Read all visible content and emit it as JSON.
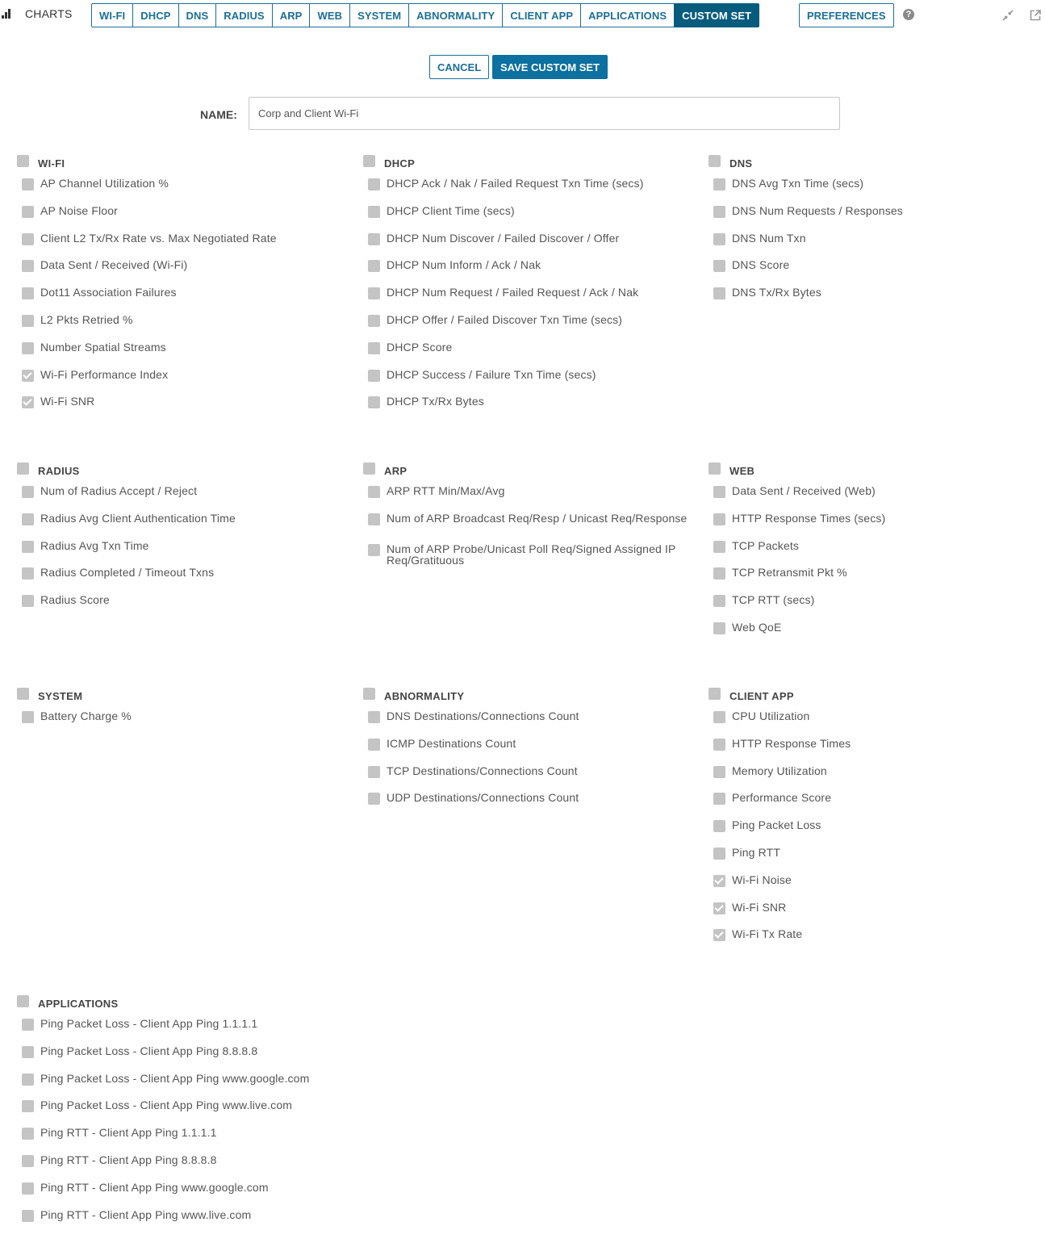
{
  "header": {
    "title": "CHARTS",
    "tabs": [
      {
        "label": "WI-FI",
        "active": false
      },
      {
        "label": "DHCP",
        "active": false
      },
      {
        "label": "DNS",
        "active": false
      },
      {
        "label": "RADIUS",
        "active": false
      },
      {
        "label": "ARP",
        "active": false
      },
      {
        "label": "WEB",
        "active": false
      },
      {
        "label": "SYSTEM",
        "active": false
      },
      {
        "label": "ABNORMALITY",
        "active": false
      },
      {
        "label": "CLIENT APP",
        "active": false
      },
      {
        "label": "APPLICATIONS",
        "active": false
      },
      {
        "label": "CUSTOM SET",
        "active": true
      }
    ],
    "preferences_label": "PREFERENCES",
    "help_glyph": "?",
    "icons": [
      "bar-chart-icon",
      "help-icon",
      "collapse-icon",
      "popout-icon"
    ]
  },
  "actions": {
    "cancel_label": "CANCEL",
    "save_label": "SAVE CUSTOM SET"
  },
  "name_field": {
    "label": "NAME:",
    "value": "Corp and Client Wi-Fi"
  },
  "colors": {
    "accent": "#1b6f98",
    "active_tab": "#075c7e",
    "save_button": "#0c70a0",
    "checkbox": "#c4c4c4"
  },
  "sections": [
    {
      "title": "WI-FI",
      "checked": false,
      "items": [
        {
          "label": "AP Channel Utilization %",
          "checked": false
        },
        {
          "label": "AP Noise Floor",
          "checked": false
        },
        {
          "label": "Client L2 Tx/Rx Rate vs. Max Negotiated Rate",
          "checked": false
        },
        {
          "label": "Data Sent / Received (Wi-Fi)",
          "checked": false
        },
        {
          "label": "Dot11 Association Failures",
          "checked": false
        },
        {
          "label": "L2 Pkts Retried %",
          "checked": false
        },
        {
          "label": "Number Spatial Streams",
          "checked": false
        },
        {
          "label": "Wi-Fi Performance Index",
          "checked": true
        },
        {
          "label": "Wi-Fi SNR",
          "checked": true
        }
      ]
    },
    {
      "title": "DHCP",
      "checked": false,
      "items": [
        {
          "label": "DHCP Ack / Nak / Failed Request Txn Time (secs)",
          "checked": false
        },
        {
          "label": "DHCP Client Time (secs)",
          "checked": false
        },
        {
          "label": "DHCP Num Discover / Failed Discover / Offer",
          "checked": false
        },
        {
          "label": "DHCP Num Inform / Ack / Nak",
          "checked": false
        },
        {
          "label": "DHCP Num Request / Failed Request / Ack / Nak",
          "checked": false
        },
        {
          "label": "DHCP Offer / Failed Discover Txn Time (secs)",
          "checked": false
        },
        {
          "label": "DHCP Score",
          "checked": false
        },
        {
          "label": "DHCP Success / Failure Txn Time (secs)",
          "checked": false
        },
        {
          "label": "DHCP Tx/Rx Bytes",
          "checked": false
        }
      ]
    },
    {
      "title": "DNS",
      "checked": false,
      "items": [
        {
          "label": "DNS Avg Txn Time (secs)",
          "checked": false
        },
        {
          "label": "DNS Num Requests / Responses",
          "checked": false
        },
        {
          "label": "DNS Num Txn",
          "checked": false
        },
        {
          "label": "DNS Score",
          "checked": false
        },
        {
          "label": "DNS Tx/Rx Bytes",
          "checked": false
        }
      ]
    },
    {
      "title": "RADIUS",
      "checked": false,
      "items": [
        {
          "label": "Num of Radius Accept / Reject",
          "checked": false
        },
        {
          "label": "Radius Avg Client Authentication Time",
          "checked": false
        },
        {
          "label": "Radius Avg Txn Time",
          "checked": false
        },
        {
          "label": "Radius Completed / Timeout Txns",
          "checked": false
        },
        {
          "label": "Radius Score",
          "checked": false
        }
      ]
    },
    {
      "title": "ARP",
      "checked": false,
      "items": [
        {
          "label": "ARP RTT Min/Max/Avg",
          "checked": false
        },
        {
          "label": "Num of ARP Broadcast Req/Resp / Unicast Req/Response",
          "checked": false
        },
        {
          "label": "Num of ARP Probe/Unicast Poll Req/Signed Assigned IP Req/Gratituous",
          "checked": false
        }
      ]
    },
    {
      "title": "WEB",
      "checked": false,
      "items": [
        {
          "label": "Data Sent / Received (Web)",
          "checked": false
        },
        {
          "label": "HTTP Response Times (secs)",
          "checked": false
        },
        {
          "label": "TCP Packets",
          "checked": false
        },
        {
          "label": "TCP Retransmit Pkt %",
          "checked": false
        },
        {
          "label": "TCP RTT (secs)",
          "checked": false
        },
        {
          "label": "Web QoE",
          "checked": false
        }
      ]
    },
    {
      "title": "SYSTEM",
      "checked": false,
      "items": [
        {
          "label": "Battery Charge %",
          "checked": false
        }
      ]
    },
    {
      "title": "ABNORMALITY",
      "checked": false,
      "items": [
        {
          "label": "DNS Destinations/Connections Count",
          "checked": false
        },
        {
          "label": "ICMP Destinations Count",
          "checked": false
        },
        {
          "label": "TCP Destinations/Connections Count",
          "checked": false
        },
        {
          "label": "UDP Destinations/Connections Count",
          "checked": false
        }
      ]
    },
    {
      "title": "CLIENT APP",
      "checked": false,
      "items": [
        {
          "label": "CPU Utilization",
          "checked": false
        },
        {
          "label": "HTTP Response Times",
          "checked": false
        },
        {
          "label": "Memory Utilization",
          "checked": false
        },
        {
          "label": "Performance Score",
          "checked": false
        },
        {
          "label": "Ping Packet Loss",
          "checked": false
        },
        {
          "label": "Ping RTT",
          "checked": false
        },
        {
          "label": "Wi-Fi Noise",
          "checked": true
        },
        {
          "label": "Wi-Fi SNR",
          "checked": true
        },
        {
          "label": "Wi-Fi Tx Rate",
          "checked": true
        }
      ]
    },
    {
      "title": "APPLICATIONS",
      "checked": false,
      "items": [
        {
          "label": "Ping Packet Loss - Client App Ping 1.1.1.1",
          "checked": false
        },
        {
          "label": "Ping Packet Loss - Client App Ping 8.8.8.8",
          "checked": false
        },
        {
          "label": "Ping Packet Loss - Client App Ping www.google.com",
          "checked": false
        },
        {
          "label": "Ping Packet Loss - Client App Ping www.live.com",
          "checked": false
        },
        {
          "label": "Ping RTT - Client App Ping 1.1.1.1",
          "checked": false
        },
        {
          "label": "Ping RTT - Client App Ping 8.8.8.8",
          "checked": false
        },
        {
          "label": "Ping RTT - Client App Ping www.google.com",
          "checked": false
        },
        {
          "label": "Ping RTT - Client App Ping www.live.com",
          "checked": false
        }
      ]
    }
  ]
}
